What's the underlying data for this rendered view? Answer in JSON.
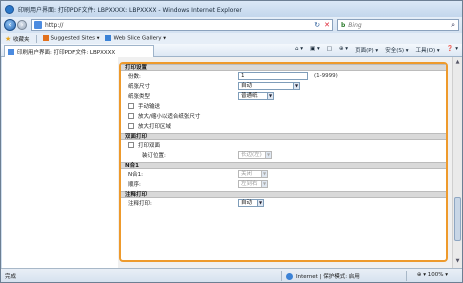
{
  "window": {
    "title": "印刷用户界面: 打印PDF文件: LBPXXXX: LBPXXXX - Windows Internet Explorer"
  },
  "address": {
    "url": "http://",
    "refresh": "↻",
    "stop": "✕",
    "search_provider": "b",
    "search_placeholder": "Bing"
  },
  "favorites": {
    "label": "收藏夹",
    "items": [
      "Suggested Sites ▾",
      "Web Slice Gallery ▾"
    ]
  },
  "tab": {
    "label": "印刷用户界面: 打印PDF文件: LBPXXXX"
  },
  "commands": [
    "⌂ ▾",
    "▣ ▾",
    "□",
    "⊕ ▾",
    "页面(P) ▾",
    "安全(S) ▾",
    "工具(O) ▾",
    "❓ ▾"
  ],
  "print_settings": {
    "section_title": "打印设置",
    "copies_label": "份数:",
    "copies_value": "1",
    "copies_range": "(1-9999)",
    "paper_size_label": "纸张尺寸",
    "paper_size_value": "自动",
    "paper_type_label": "纸张类型",
    "paper_type_value": "普通纸",
    "manual_feed": "手动输送",
    "fit_to_paper": "放大/缩小以适合纸张尺寸",
    "max_print_area": "放大打印区域"
  },
  "duplex": {
    "section_title": "双面打印",
    "checkbox_label": "打印双面",
    "binding_label": "装订位置:",
    "binding_value": "长边(左)"
  },
  "nup": {
    "section_title": "N合1",
    "nup_label": "N合1:",
    "nup_value": "关闭",
    "order_label": "顺序:",
    "order_value": "左到右"
  },
  "annotation": {
    "section_title": "注释打印",
    "label": "注释打印:",
    "value": "自动"
  },
  "status": {
    "left": "完成",
    "zone": "Internet | 保护模式: 启用",
    "zoom": "100%"
  }
}
